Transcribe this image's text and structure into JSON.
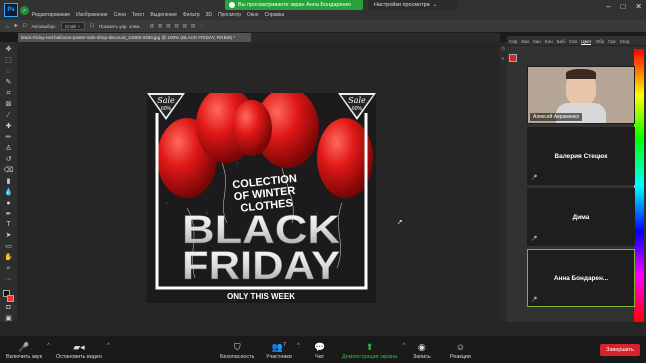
{
  "app": {
    "logo_text": "Ps",
    "menus": [
      "Редактирование",
      "Изображение",
      "Слои",
      "Текст",
      "Выделение",
      "Фильтр",
      "3D",
      "Просмотр",
      "Окно",
      "Справка"
    ],
    "share_banner": "Вы просматриваете экран Анна Бондаренко",
    "view_options": "Настройки просмотра"
  },
  "options_bar": {
    "autoselect_label": "Автовыбор:",
    "autoselect_value": "Слой",
    "transform_label": "Показать упр. элем."
  },
  "document": {
    "tab_title": "black-friday-red-balloons-poster-sale-shop-discount_24908-3283.jpg @ 100% (BLACK FRIDAY, RGB/8) *"
  },
  "poster": {
    "sale": "Sale",
    "sale_percent": "60%",
    "line1": "COLECTION",
    "line2": "OF WINTER",
    "line3": "CLOTHES",
    "black": "BLACK",
    "friday": "FRIDAY",
    "footer": "ONLY THIS WEEK"
  },
  "panel": {
    "tabs": [
      "Свр",
      "Кан",
      "Кан",
      "Кон",
      "Биб",
      "Сво",
      "Цвет",
      "Обр",
      "Гра",
      "Узор"
    ],
    "active_tab_index": 6
  },
  "participants": [
    {
      "name": "Алексей Авраменко",
      "video": true
    },
    {
      "name": "Валерия Стецюк",
      "video": false
    },
    {
      "name": "Дима",
      "video": false
    },
    {
      "name": "Анна  Бондарен...",
      "video": false,
      "active": true
    }
  ],
  "meeting_controls": {
    "unmute": "Включить звук",
    "video": "Остановить видео",
    "security": "Безопасность",
    "participants": "Участники",
    "participants_count": "7",
    "chat": "Чат",
    "share": "Демонстрация экрана",
    "record": "Запись",
    "reactions": "Реакции",
    "end": "Завершить"
  },
  "colors": {
    "share_green": "#26a43a",
    "end_red": "#d8232f",
    "balloon_red": "#e01818",
    "active_tile_border": "#7ab72a"
  }
}
